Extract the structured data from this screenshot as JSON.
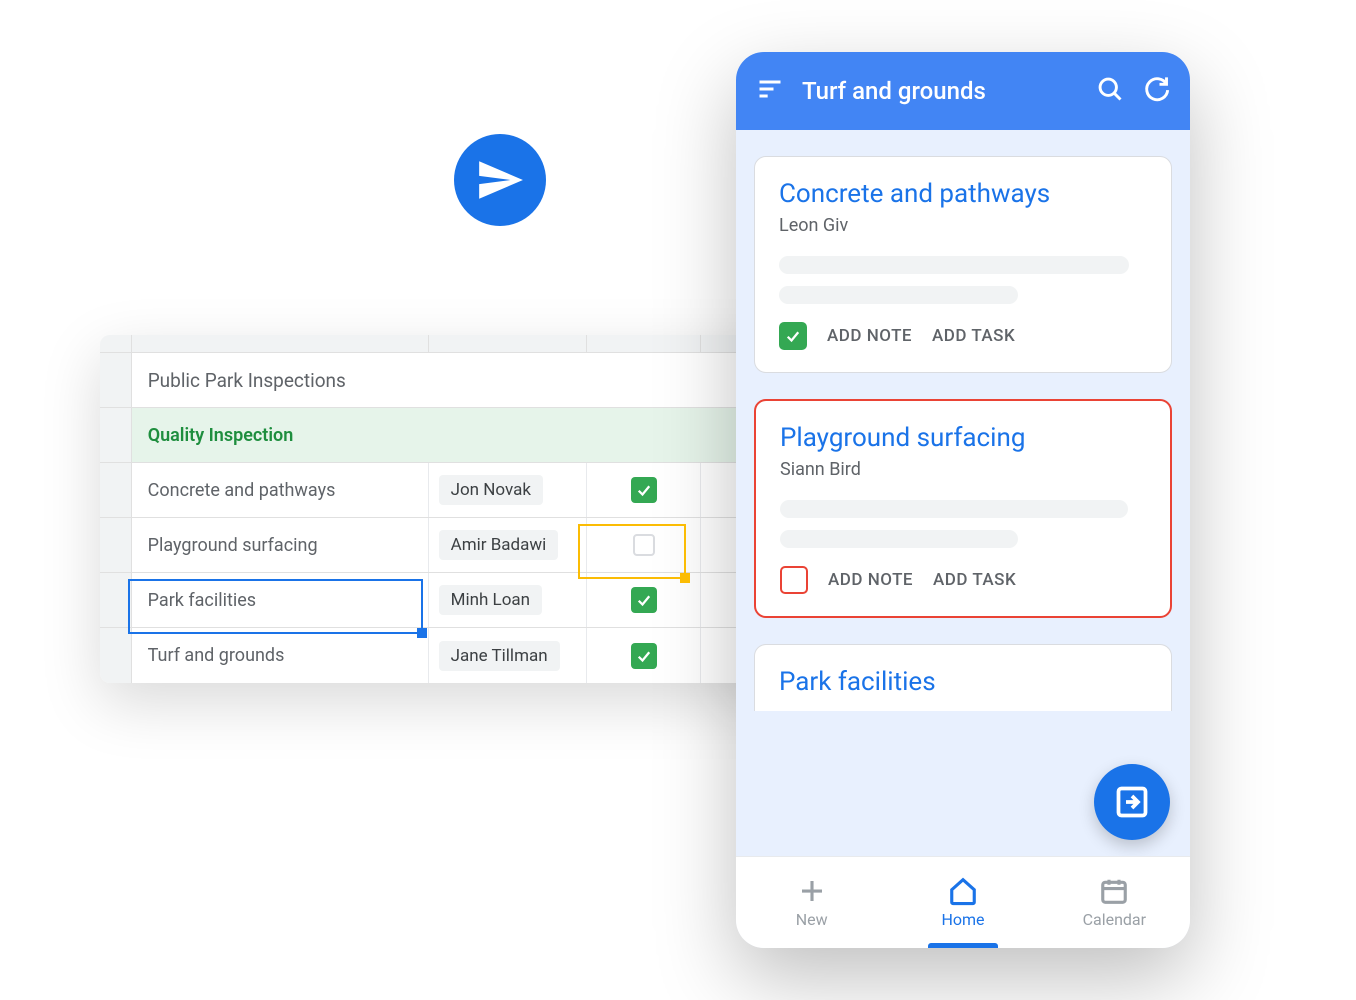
{
  "icons": {
    "paper_plane": "paper-plane-icon"
  },
  "spreadsheet": {
    "title": "Public Park Inspections",
    "section": "Quality Inspection",
    "rows": [
      {
        "task": "Concrete and pathways",
        "assignee": "Jon Novak",
        "checked": true
      },
      {
        "task": "Playground surfacing",
        "assignee": "Amir Badawi",
        "checked": false
      },
      {
        "task": "Park facilities",
        "assignee": "Minh Loan",
        "checked": true
      },
      {
        "task": "Turf and grounds",
        "assignee": "Jane Tillman",
        "checked": true
      }
    ]
  },
  "mobile": {
    "header_title": "Turf and grounds",
    "cards": [
      {
        "title": "Concrete and pathways",
        "subtitle": "Leon Giv",
        "checked": true,
        "add_note": "ADD NOTE",
        "add_task": "ADD TASK"
      },
      {
        "title": "Playground surfacing",
        "subtitle": "Siann Bird",
        "checked": false,
        "add_note": "ADD NOTE",
        "add_task": "ADD TASK"
      }
    ],
    "peek_card_title": "Park facilities",
    "nav": {
      "new": "New",
      "home": "Home",
      "calendar": "Calendar"
    }
  }
}
